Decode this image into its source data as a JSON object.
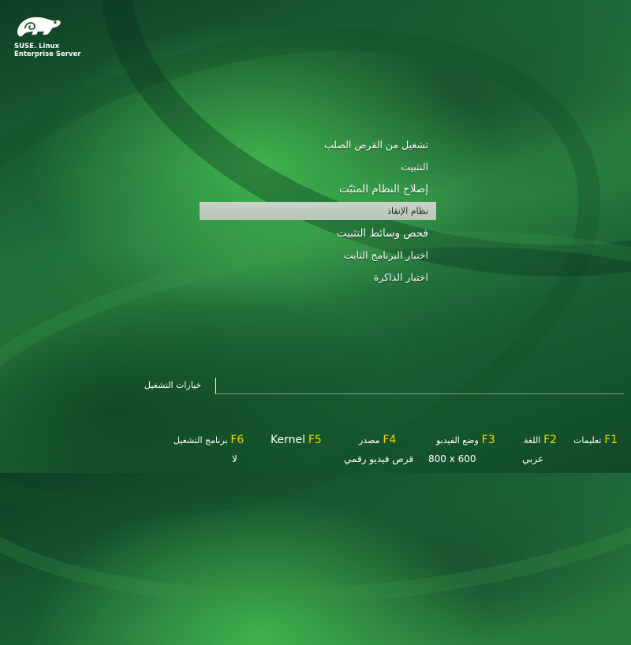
{
  "brand": {
    "line1": "SUSE. Linux",
    "line2": "Enterprise Server"
  },
  "menu": {
    "items": [
      {
        "label": "تشغيل من القرص الصلب",
        "selected": false
      },
      {
        "label": "التثبيت",
        "selected": false
      },
      {
        "label": "إصلاح النظام المثبّت",
        "selected": false
      },
      {
        "label": "نظام الإنقاذ",
        "selected": true
      },
      {
        "label": "فحص وسائط التثبيت",
        "selected": false
      },
      {
        "label": "اختبار البرنامج الثابت",
        "selected": false
      },
      {
        "label": "اختبار الذاكرة",
        "selected": false
      }
    ]
  },
  "boot_options": {
    "label": "خيارات التشغيل",
    "value": ""
  },
  "function_keys": [
    {
      "key": "F1",
      "label": "تعليمات",
      "value": ""
    },
    {
      "key": "F2",
      "label": "اللغة",
      "value": "عربي"
    },
    {
      "key": "F3",
      "label": "وضع الفيديو",
      "value": "800 x 600"
    },
    {
      "key": "F4",
      "label": "مصدر",
      "value": "قرص فيديو رقمي"
    },
    {
      "key": "F5",
      "label": "Kernel",
      "value": ""
    },
    {
      "key": "F6",
      "label": "برنامج التشغيل",
      "value": "لا"
    }
  ],
  "colors": {
    "fkey_accent": "#f1d700",
    "selection_bg": "#c3cec0",
    "text": "#ffffff"
  }
}
